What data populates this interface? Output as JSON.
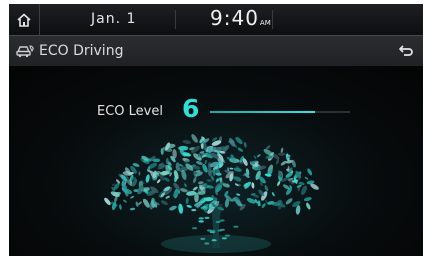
{
  "status_bar": {
    "date": "Jan. 1",
    "time": "9:40",
    "ampm": "AM"
  },
  "header": {
    "title": "ECO Driving",
    "icon": "car-eco-icon",
    "back_icon": "back-arrow-icon",
    "home_icon": "home-icon"
  },
  "eco": {
    "label": "ECO Level",
    "level": "6",
    "level_fraction": 0.75
  },
  "colors": {
    "accent": "#2ee0d8",
    "background": "#050606"
  }
}
